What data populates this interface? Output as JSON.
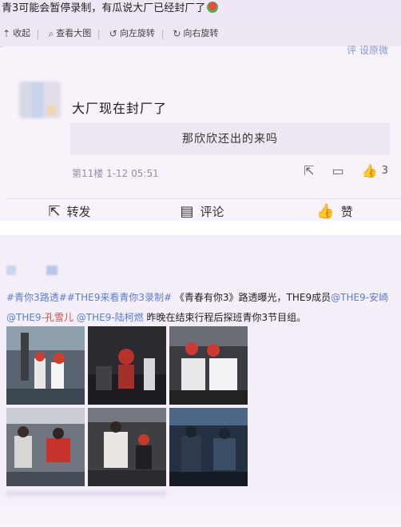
{
  "title": "青3可能会暂停录制，有瓜说大厂已经封厂了",
  "toolbar": {
    "collapse": "收起",
    "view_large": "查看大图",
    "rotate_left": "向左旋转",
    "rotate_right": "向右旋转"
  },
  "comment": {
    "cutoff_link": "评 设原微",
    "text": "大厂现在封厂了",
    "reply": "那欣欣还出的来吗",
    "meta": "第11楼 1-12 05:51",
    "like_count": "3"
  },
  "actions": {
    "repost": "转发",
    "comment": "评论",
    "like": "赞"
  },
  "post": {
    "tag1": "#青你3路透#",
    "tag2": "#THE9来看青你3录制#",
    "text1": "《青春有你3》路透曝光，THE9成员",
    "mention1": "@THE9-安崎",
    "mention2_a": "@THE9-",
    "mention2_b": "孔雪儿",
    "mention3": "@THE9-陆柯燃",
    "text2": "昨晚在结束行程后探班青你3节目组。"
  }
}
